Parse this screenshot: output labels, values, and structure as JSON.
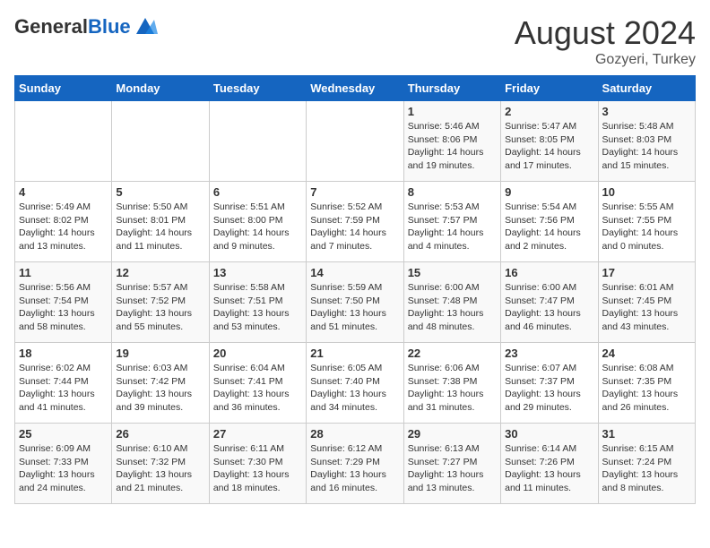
{
  "logo": {
    "general": "General",
    "blue": "Blue"
  },
  "header": {
    "title": "August 2024",
    "subtitle": "Gozyeri, Turkey"
  },
  "calendar": {
    "days_of_week": [
      "Sunday",
      "Monday",
      "Tuesday",
      "Wednesday",
      "Thursday",
      "Friday",
      "Saturday"
    ],
    "weeks": [
      [
        {
          "day": "",
          "info": ""
        },
        {
          "day": "",
          "info": ""
        },
        {
          "day": "",
          "info": ""
        },
        {
          "day": "",
          "info": ""
        },
        {
          "day": "1",
          "info": "Sunrise: 5:46 AM\nSunset: 8:06 PM\nDaylight: 14 hours\nand 19 minutes."
        },
        {
          "day": "2",
          "info": "Sunrise: 5:47 AM\nSunset: 8:05 PM\nDaylight: 14 hours\nand 17 minutes."
        },
        {
          "day": "3",
          "info": "Sunrise: 5:48 AM\nSunset: 8:03 PM\nDaylight: 14 hours\nand 15 minutes."
        }
      ],
      [
        {
          "day": "4",
          "info": "Sunrise: 5:49 AM\nSunset: 8:02 PM\nDaylight: 14 hours\nand 13 minutes."
        },
        {
          "day": "5",
          "info": "Sunrise: 5:50 AM\nSunset: 8:01 PM\nDaylight: 14 hours\nand 11 minutes."
        },
        {
          "day": "6",
          "info": "Sunrise: 5:51 AM\nSunset: 8:00 PM\nDaylight: 14 hours\nand 9 minutes."
        },
        {
          "day": "7",
          "info": "Sunrise: 5:52 AM\nSunset: 7:59 PM\nDaylight: 14 hours\nand 7 minutes."
        },
        {
          "day": "8",
          "info": "Sunrise: 5:53 AM\nSunset: 7:57 PM\nDaylight: 14 hours\nand 4 minutes."
        },
        {
          "day": "9",
          "info": "Sunrise: 5:54 AM\nSunset: 7:56 PM\nDaylight: 14 hours\nand 2 minutes."
        },
        {
          "day": "10",
          "info": "Sunrise: 5:55 AM\nSunset: 7:55 PM\nDaylight: 14 hours\nand 0 minutes."
        }
      ],
      [
        {
          "day": "11",
          "info": "Sunrise: 5:56 AM\nSunset: 7:54 PM\nDaylight: 13 hours\nand 58 minutes."
        },
        {
          "day": "12",
          "info": "Sunrise: 5:57 AM\nSunset: 7:52 PM\nDaylight: 13 hours\nand 55 minutes."
        },
        {
          "day": "13",
          "info": "Sunrise: 5:58 AM\nSunset: 7:51 PM\nDaylight: 13 hours\nand 53 minutes."
        },
        {
          "day": "14",
          "info": "Sunrise: 5:59 AM\nSunset: 7:50 PM\nDaylight: 13 hours\nand 51 minutes."
        },
        {
          "day": "15",
          "info": "Sunrise: 6:00 AM\nSunset: 7:48 PM\nDaylight: 13 hours\nand 48 minutes."
        },
        {
          "day": "16",
          "info": "Sunrise: 6:00 AM\nSunset: 7:47 PM\nDaylight: 13 hours\nand 46 minutes."
        },
        {
          "day": "17",
          "info": "Sunrise: 6:01 AM\nSunset: 7:45 PM\nDaylight: 13 hours\nand 43 minutes."
        }
      ],
      [
        {
          "day": "18",
          "info": "Sunrise: 6:02 AM\nSunset: 7:44 PM\nDaylight: 13 hours\nand 41 minutes."
        },
        {
          "day": "19",
          "info": "Sunrise: 6:03 AM\nSunset: 7:42 PM\nDaylight: 13 hours\nand 39 minutes."
        },
        {
          "day": "20",
          "info": "Sunrise: 6:04 AM\nSunset: 7:41 PM\nDaylight: 13 hours\nand 36 minutes."
        },
        {
          "day": "21",
          "info": "Sunrise: 6:05 AM\nSunset: 7:40 PM\nDaylight: 13 hours\nand 34 minutes."
        },
        {
          "day": "22",
          "info": "Sunrise: 6:06 AM\nSunset: 7:38 PM\nDaylight: 13 hours\nand 31 minutes."
        },
        {
          "day": "23",
          "info": "Sunrise: 6:07 AM\nSunset: 7:37 PM\nDaylight: 13 hours\nand 29 minutes."
        },
        {
          "day": "24",
          "info": "Sunrise: 6:08 AM\nSunset: 7:35 PM\nDaylight: 13 hours\nand 26 minutes."
        }
      ],
      [
        {
          "day": "25",
          "info": "Sunrise: 6:09 AM\nSunset: 7:33 PM\nDaylight: 13 hours\nand 24 minutes."
        },
        {
          "day": "26",
          "info": "Sunrise: 6:10 AM\nSunset: 7:32 PM\nDaylight: 13 hours\nand 21 minutes."
        },
        {
          "day": "27",
          "info": "Sunrise: 6:11 AM\nSunset: 7:30 PM\nDaylight: 13 hours\nand 18 minutes."
        },
        {
          "day": "28",
          "info": "Sunrise: 6:12 AM\nSunset: 7:29 PM\nDaylight: 13 hours\nand 16 minutes."
        },
        {
          "day": "29",
          "info": "Sunrise: 6:13 AM\nSunset: 7:27 PM\nDaylight: 13 hours\nand 13 minutes."
        },
        {
          "day": "30",
          "info": "Sunrise: 6:14 AM\nSunset: 7:26 PM\nDaylight: 13 hours\nand 11 minutes."
        },
        {
          "day": "31",
          "info": "Sunrise: 6:15 AM\nSunset: 7:24 PM\nDaylight: 13 hours\nand 8 minutes."
        }
      ]
    ]
  }
}
